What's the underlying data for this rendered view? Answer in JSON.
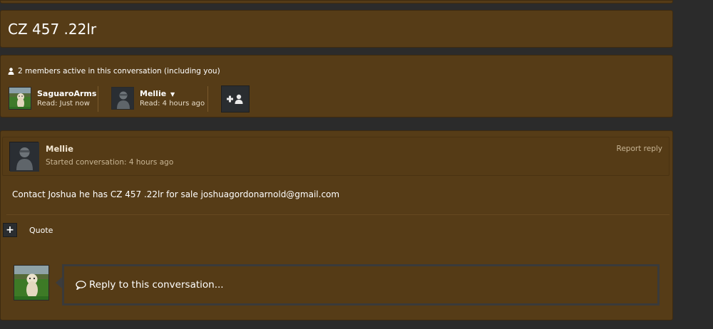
{
  "thread": {
    "title": "CZ 457 .22lr"
  },
  "members": {
    "active_text": "2 members active in this conversation (including you)",
    "list": [
      {
        "name": "SaguaroArms",
        "read": "Read: Just now"
      },
      {
        "name": "Mellie",
        "read": "Read: 4 hours ago"
      }
    ],
    "invite_icon": "add-user-icon"
  },
  "message": {
    "author": "Mellie",
    "started": "Started conversation: 4 hours ago",
    "report": "Report reply",
    "body": "Contact Joshua he has CZ 457 .22lr for sale joshuagordonarnold@gmail.com",
    "quote_label": "Quote"
  },
  "reply": {
    "placeholder": "Reply to this conversation..."
  },
  "colors": {
    "panel": "#563c17",
    "background": "#2b2b2b",
    "dark_button": "#2a2d30"
  }
}
